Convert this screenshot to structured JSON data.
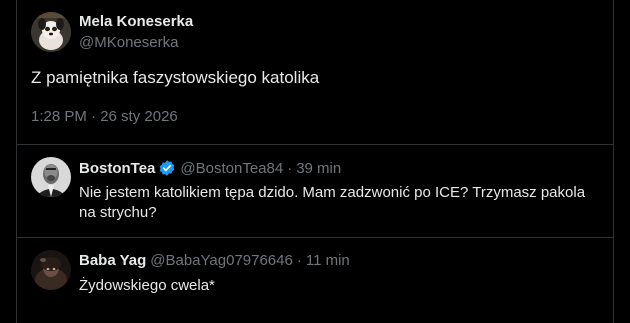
{
  "main_tweet": {
    "author_name": "Mela Koneserka",
    "author_handle": "@MKoneserka",
    "text": "Z pamiętnika faszystowskiego katolika",
    "timestamp": "1:28 PM · 26 sty 2026",
    "avatar_icon": "dog-avatar"
  },
  "replies": [
    {
      "author_name": "BostonTea",
      "author_handle": "@BostonTea84",
      "separator": "·",
      "time": "39 min",
      "verified": true,
      "verified_color": "#1d9bf0",
      "text": "Nie jestem katolikiem tępa dzido. Mam zadzwonić po ICE? Trzymasz pakola na strychu?",
      "avatar_icon": "man-portrait-avatar"
    },
    {
      "author_name": "Baba Yag",
      "author_handle": "@BabaYag07976646",
      "separator": "·",
      "time": "11 min",
      "verified": false,
      "text": "Żydowskiego cwela*",
      "avatar_icon": "dark-figure-avatar"
    }
  ],
  "colors": {
    "background": "#000000",
    "text_primary": "#e7e9ea",
    "text_secondary": "#71767b",
    "divider": "#2f3336"
  }
}
